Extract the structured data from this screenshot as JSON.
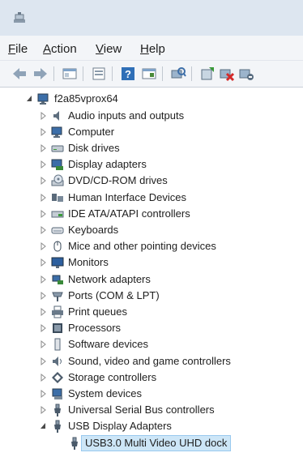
{
  "menu": [
    "File",
    "Action",
    "View",
    "Help"
  ],
  "menu_access_keys": [
    "F",
    "A",
    "V",
    "H"
  ],
  "toolbar": [
    "back-icon",
    "forward-icon",
    "show-hide-console-tree-icon",
    "properties-icon",
    "help-icon",
    "show-action-pane-icon",
    "scan-hardware-icon",
    "update-driver-icon",
    "uninstall-device-icon",
    "disable-device-icon"
  ],
  "tree": {
    "root": "f2a85vprox64",
    "categories": [
      {
        "label": "Audio inputs and outputs",
        "icon": "speaker-icon"
      },
      {
        "label": "Computer",
        "icon": "computer-icon"
      },
      {
        "label": "Disk drives",
        "icon": "disk-drive-icon"
      },
      {
        "label": "Display adapters",
        "icon": "display-adapter-icon"
      },
      {
        "label": "DVD/CD-ROM drives",
        "icon": "dvd-drive-icon"
      },
      {
        "label": "Human Interface Devices",
        "icon": "hid-icon"
      },
      {
        "label": "IDE ATA/ATAPI controllers",
        "icon": "ide-controller-icon"
      },
      {
        "label": "Keyboards",
        "icon": "keyboard-icon"
      },
      {
        "label": "Mice and other pointing devices",
        "icon": "mouse-icon"
      },
      {
        "label": "Monitors",
        "icon": "monitor-icon"
      },
      {
        "label": "Network adapters",
        "icon": "network-adapter-icon"
      },
      {
        "label": "Ports (COM & LPT)",
        "icon": "port-icon"
      },
      {
        "label": "Print queues",
        "icon": "printer-icon"
      },
      {
        "label": "Processors",
        "icon": "processor-icon"
      },
      {
        "label": "Software devices",
        "icon": "software-device-icon"
      },
      {
        "label": "Sound, video and game controllers",
        "icon": "sound-icon"
      },
      {
        "label": "Storage controllers",
        "icon": "storage-controller-icon"
      },
      {
        "label": "System devices",
        "icon": "system-device-icon"
      },
      {
        "label": "Universal Serial Bus controllers",
        "icon": "usb-icon"
      },
      {
        "label": "USB Display Adapters",
        "icon": "usb-icon",
        "expanded": true
      }
    ],
    "selected_child": {
      "label": "USB3.0 Multi Video UHD dock",
      "icon": "usb-icon"
    }
  }
}
